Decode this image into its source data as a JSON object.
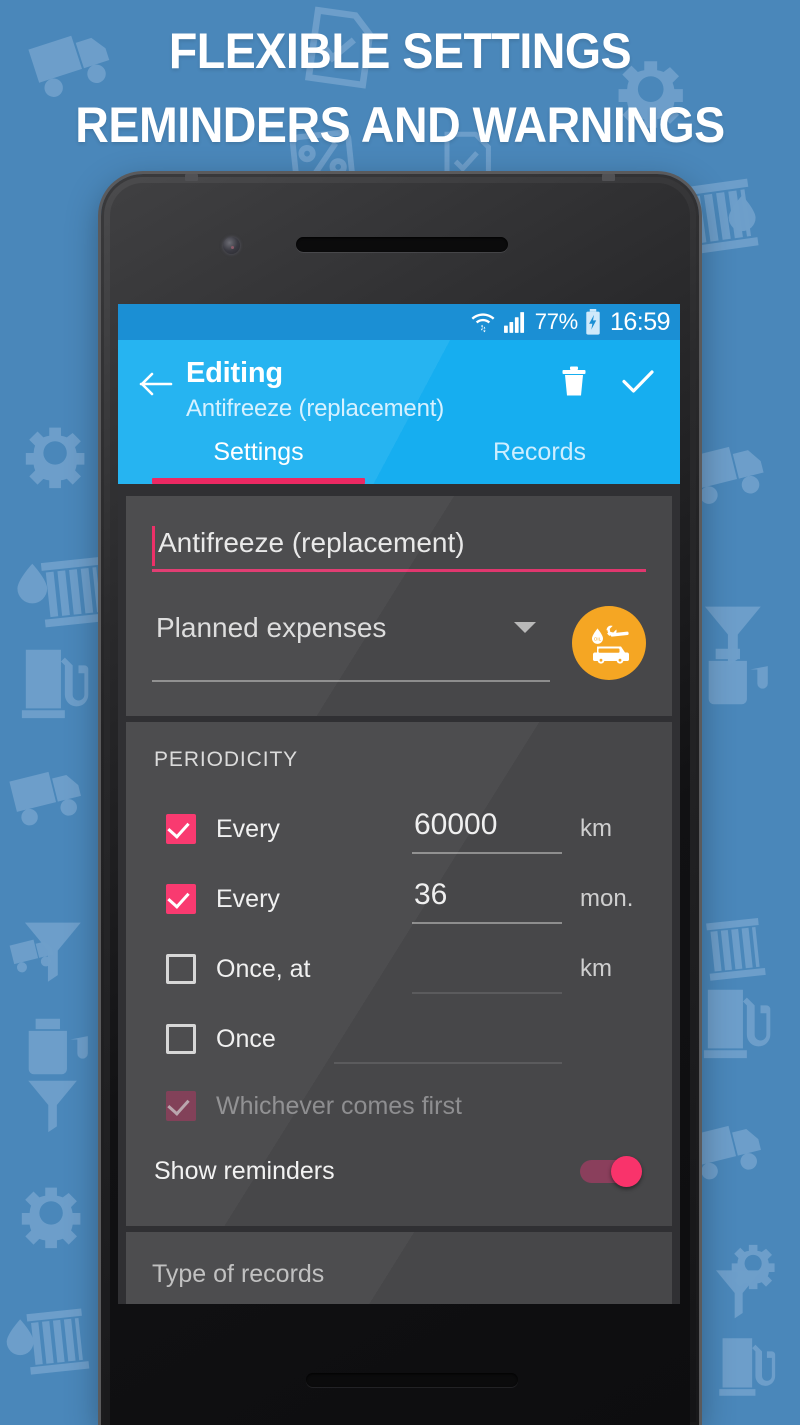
{
  "headline": {
    "line1": "FLEXIBLE SETTINGS",
    "line2": "REMINDERS AND WARNINGS"
  },
  "colors": {
    "background": "#4a87ba",
    "watermark": "#6fa0cb",
    "statusbar": "#1b8fd4",
    "appbar": "#16aef0",
    "accent_pink": "#ec2963",
    "toggle_pink": "#f9336b",
    "card": "#474749",
    "screen_background": "#303033",
    "category_orange": "#f5a623"
  },
  "statusbar": {
    "wifi_icon": "wifi-icon",
    "signal_icon": "cellular-signal-icon",
    "battery_percent": "77%",
    "battery_icon": "battery-charging-icon",
    "clock": "16:59"
  },
  "appbar": {
    "back_icon": "back-arrow-icon",
    "title": "Editing",
    "subtitle": "Antifreeze (replacement)",
    "delete_icon": "trash-icon",
    "save_icon": "check-icon",
    "tabs": [
      {
        "label": "Settings",
        "active": true
      },
      {
        "label": "Records",
        "active": false
      }
    ]
  },
  "card_main": {
    "name_field": {
      "value": "Antifreeze (replacement)",
      "placeholder": "Name"
    },
    "category_spinner": {
      "value": "Planned expenses",
      "dropdown_icon": "chevron-down-icon"
    },
    "category_icon": "car-service-icon"
  },
  "card_periodicity": {
    "section_label": "PERIODICITY",
    "rows": [
      {
        "checkbox": "checked",
        "label": "Every",
        "value": "60000",
        "unit": "km",
        "enabled": true
      },
      {
        "checkbox": "checked",
        "label": "Every",
        "value": "36",
        "unit": "mon.",
        "enabled": true
      },
      {
        "checkbox": "unchecked",
        "label": "Once, at",
        "value": "",
        "unit": "km",
        "enabled": true
      },
      {
        "checkbox": "unchecked",
        "label": "Once",
        "value": "",
        "unit": "",
        "enabled": true
      }
    ],
    "whichever": {
      "checkbox": "checked-disabled",
      "label": "Whichever comes first"
    },
    "show_reminders": {
      "label": "Show reminders",
      "state": "on"
    }
  },
  "card_records": {
    "label": "Type of records"
  }
}
